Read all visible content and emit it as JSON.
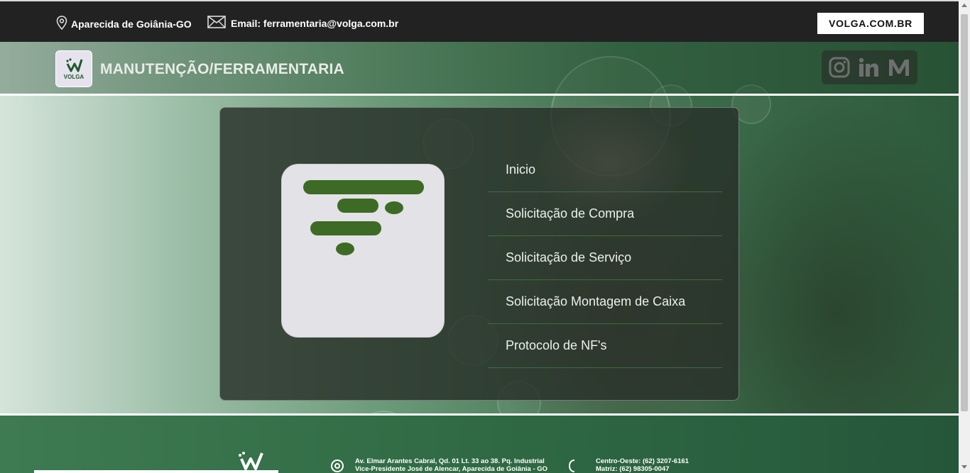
{
  "topbar": {
    "location": "Aparecida de Goiânia-GO",
    "email": "Email: ferramentaria@volga.com.br",
    "site_button": "VOLGA.COM.BR"
  },
  "header": {
    "logo_text": "VOLGA",
    "title": "MANUTENÇÃO/FERRAMENTARIA",
    "social": [
      "instagram-icon",
      "linkedin-icon",
      "medium-icon"
    ]
  },
  "menu": {
    "items": [
      {
        "label": "Inicio"
      },
      {
        "label": "Solicitação de Compra"
      },
      {
        "label": "Solicitação de Serviço"
      },
      {
        "label": "Solicitação Montagem de Caixa"
      },
      {
        "label": "Protocolo de NF's"
      }
    ]
  },
  "footer": {
    "address_line1": "Av. Elmar Arantes Cabral, Qd. 01 Lt. 33 ao 38. Pq. Industrial",
    "address_line2": "Vice-Presidente José de Alencar, Aparecida de Goiânia - GO",
    "phone_line1": "Centro-Oeste: (62) 3207-6161",
    "phone_line2": "Matriz: (62) 98305-0047"
  },
  "colors": {
    "brand_green": "#3f6b2a",
    "topbar": "#222222",
    "accent_white": "#ffffff"
  }
}
